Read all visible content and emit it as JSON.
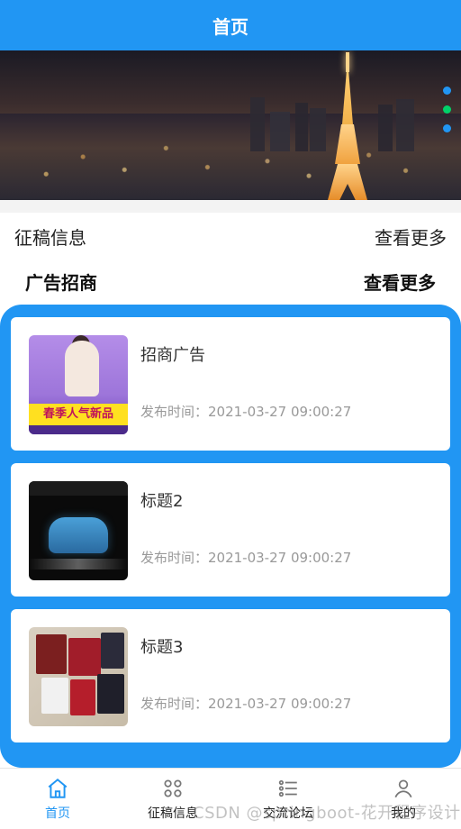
{
  "header": {
    "title": "首页"
  },
  "banner": {
    "dot_colors": [
      "#2196f3",
      "#00d26a",
      "#2196f3"
    ]
  },
  "section_call_for_papers": {
    "title": "征稿信息",
    "more": "查看更多"
  },
  "section_ads": {
    "title": "广告招商",
    "more": "查看更多"
  },
  "cards": [
    {
      "title": "招商广告",
      "time": "发布时间：2021-03-27 09:00:27",
      "thumb_text": "春季人气新品"
    },
    {
      "title": "标题2",
      "time": "发布时间：2021-03-27 09:00:27"
    },
    {
      "title": "标题3",
      "time": "发布时间：2021-03-27 09:00:27"
    }
  ],
  "tabs": [
    {
      "label": "首页",
      "icon": "home-icon",
      "active": true
    },
    {
      "label": "征稿信息",
      "icon": "grid-icon",
      "active": false
    },
    {
      "label": "交流论坛",
      "icon": "list-icon",
      "active": false
    },
    {
      "label": "我的",
      "icon": "user-icon",
      "active": false
    }
  ],
  "watermark": "CSDN @springboot-花开程序设计",
  "colors": {
    "primary": "#2196f3",
    "background": "#f3f3f3",
    "card": "#ffffff"
  }
}
